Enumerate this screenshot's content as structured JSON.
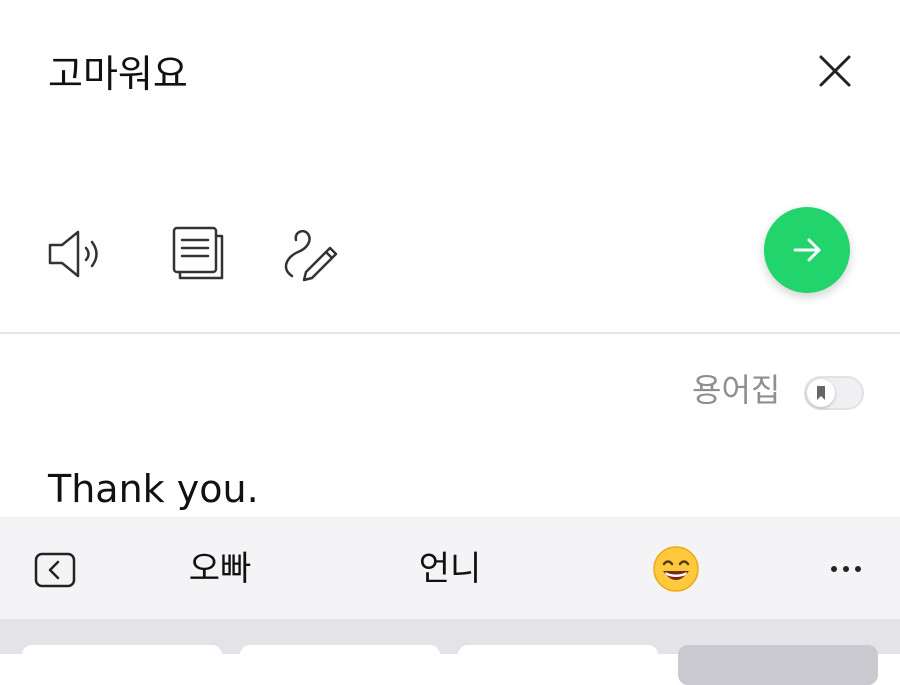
{
  "source": {
    "text": "고마워요"
  },
  "icons": {
    "close": "close-icon",
    "speaker": "speaker-icon",
    "copy": "copy-icon",
    "handwrite": "handwriting-icon",
    "send": "arrow-right-icon",
    "bookmark": "bookmark-icon",
    "back": "chevron-left-icon",
    "more": "more-icon"
  },
  "glossary": {
    "label": "용어집",
    "enabled": false
  },
  "translation": {
    "text": "Thank you."
  },
  "keyboard": {
    "suggestions": [
      "오빠",
      "언니"
    ],
    "emoji": "😄"
  },
  "colors": {
    "accent": "#21d46b",
    "muted_text": "#8e8e93",
    "toolbar_bg": "#f4f4f6"
  }
}
